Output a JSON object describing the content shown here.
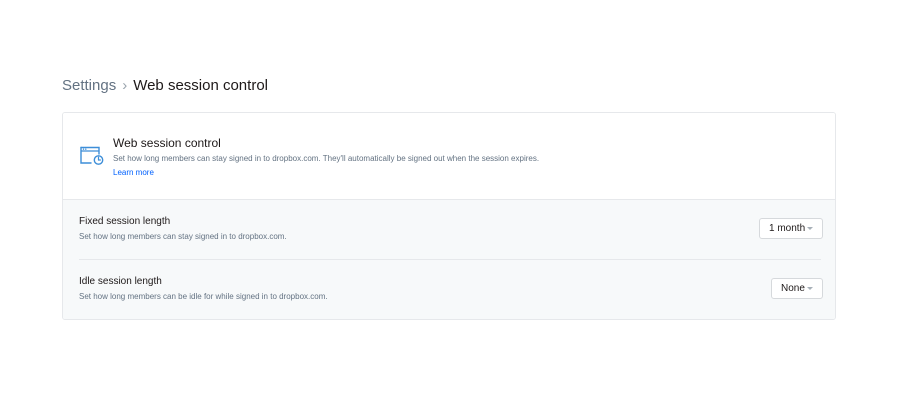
{
  "breadcrumb": {
    "parent": "Settings",
    "separator": "›",
    "current": "Web session control"
  },
  "card": {
    "icon": "browser-timer-icon",
    "title": "Web session control",
    "description": "Set how long members can stay signed in to dropbox.com. They'll automatically be signed out when the session expires.",
    "learn_more": "Learn more"
  },
  "settings": [
    {
      "title": "Fixed session length",
      "description": "Set how long members can stay signed in to dropbox.com.",
      "value": "1 month"
    },
    {
      "title": "Idle session length",
      "description": "Set how long members can be idle for while signed in to dropbox.com.",
      "value": "None"
    }
  ],
  "colors": {
    "accent": "#0061fe",
    "icon": "#3d8ed8",
    "muted_text": "#637282",
    "border": "#e6e8eb",
    "settings_background": "#f7f9fa"
  }
}
